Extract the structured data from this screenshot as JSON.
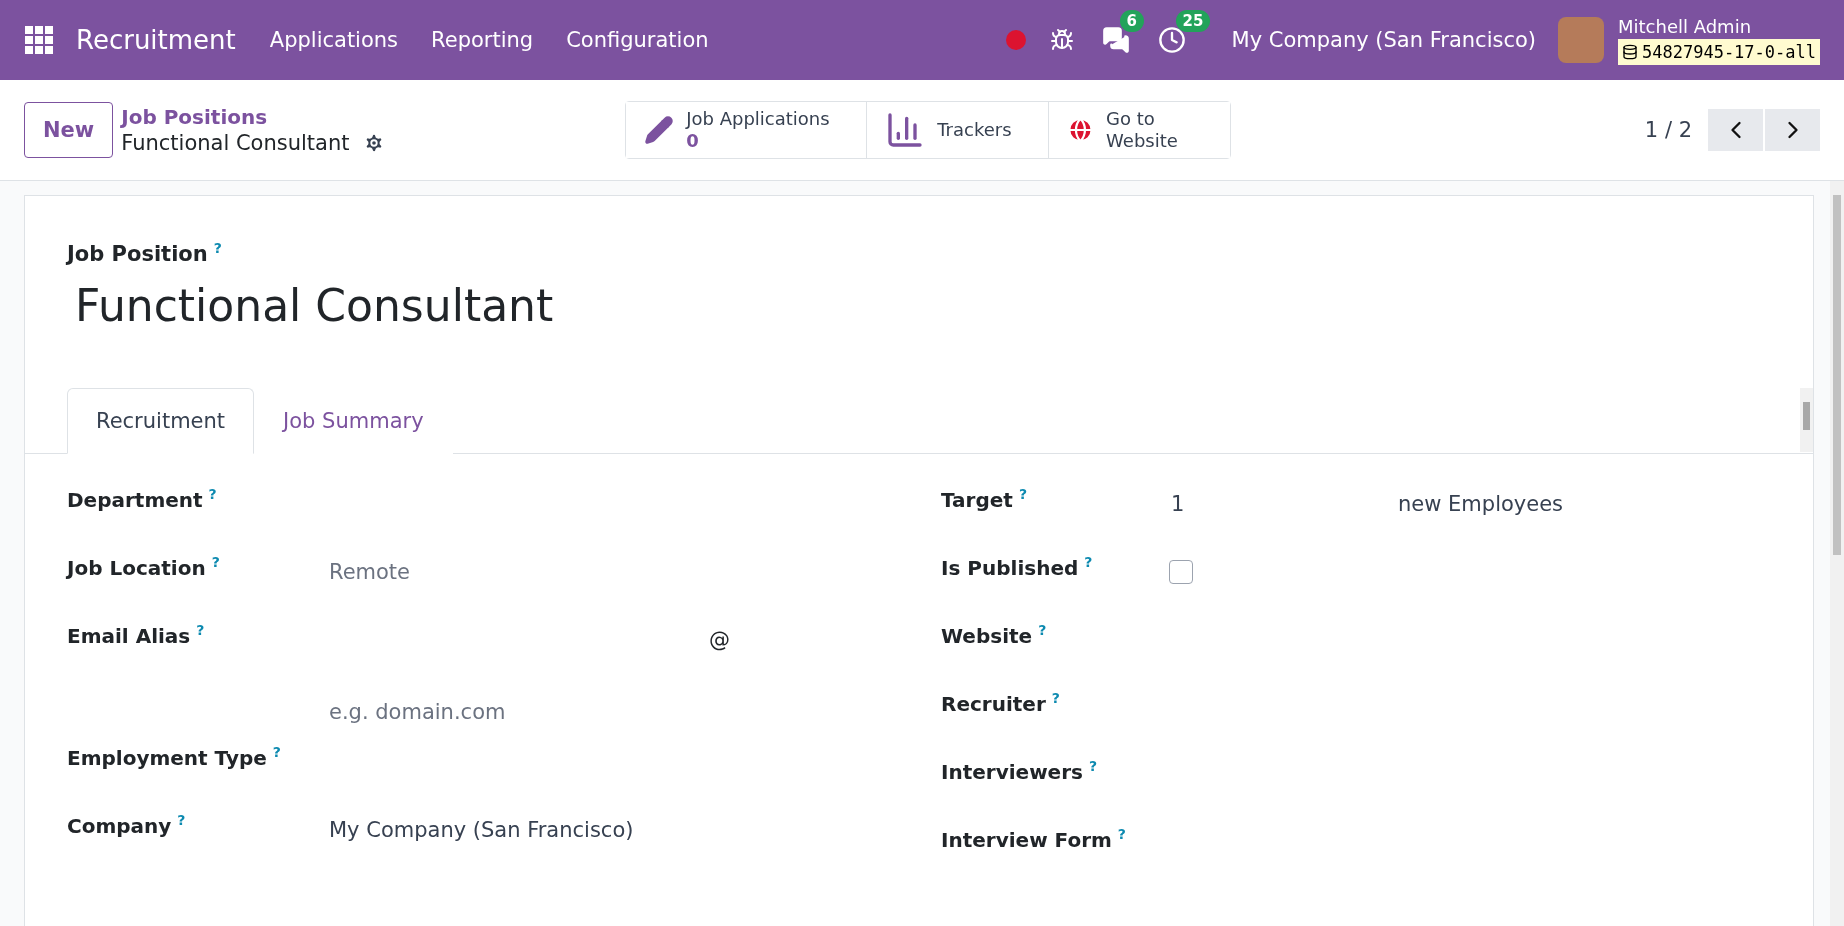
{
  "navbar": {
    "app_name": "Recruitment",
    "menu": [
      "Applications",
      "Reporting",
      "Configuration"
    ],
    "messages_badge": "6",
    "activities_badge": "25",
    "company": "My Company (San Francisco)",
    "user": "Mitchell Admin",
    "database": "54827945-17-0-all"
  },
  "control_panel": {
    "new_button": "New",
    "breadcrumb": "Job Positions",
    "record_name": "Functional Consultant",
    "stat_buttons": [
      {
        "kind": "count",
        "label": "Job Applications",
        "value": "0"
      },
      {
        "kind": "chart",
        "label": "Trackers"
      },
      {
        "kind": "globe",
        "label": "Go to Website"
      }
    ],
    "pager": "1 / 2"
  },
  "form": {
    "title_label": "Job Position",
    "tooltip_mark": "?",
    "title": "Functional Consultant",
    "tabs": [
      {
        "label": "Recruitment",
        "selected": true
      },
      {
        "label": "Job Summary",
        "selected": false
      }
    ],
    "left_fields": [
      {
        "kind": "text",
        "label": "Department"
      },
      {
        "kind": "text",
        "label": "Job Location",
        "placeholder": "Remote"
      },
      {
        "kind": "alias",
        "label": "Email Alias",
        "separator": "@",
        "placeholder": "e.g. domain.com"
      },
      {
        "kind": "text",
        "label": "Employment Type"
      },
      {
        "kind": "text",
        "label": "Company",
        "value": "My Company (San Francisco)"
      }
    ],
    "right_fields": [
      {
        "kind": "target",
        "label": "Target",
        "value": "1",
        "suffix": "new Employees"
      },
      {
        "kind": "checkbox",
        "label": "Is Published",
        "checked": false
      },
      {
        "kind": "text",
        "label": "Website"
      },
      {
        "kind": "text",
        "label": "Recruiter"
      },
      {
        "kind": "text",
        "label": "Interviewers"
      },
      {
        "kind": "text",
        "label": "Interview Form"
      }
    ]
  }
}
